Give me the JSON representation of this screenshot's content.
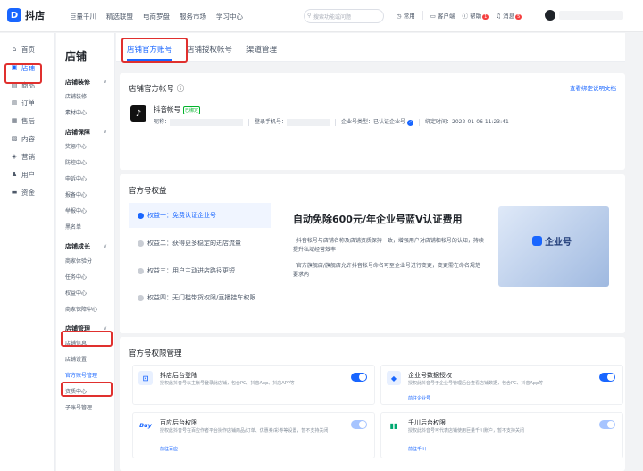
{
  "app": {
    "logo_mark": "D",
    "name": "抖店"
  },
  "topnav": [
    "巨量千川",
    "精选联盟",
    "电商罗盘",
    "服务市场",
    "学习中心"
  ],
  "search": {
    "placeholder": "搜索功能或问题"
  },
  "tools": {
    "common": "常用",
    "service": "客户端",
    "help": "帮助",
    "help_badge": "1",
    "msg": "消息",
    "msg_badge": "5"
  },
  "sidebar": [
    {
      "icon": "home-icon",
      "glyph": "⌂",
      "label": "首页"
    },
    {
      "icon": "store-icon",
      "glyph": "▣",
      "label": "店铺",
      "active": true
    },
    {
      "icon": "product-icon",
      "glyph": "▤",
      "label": "商品"
    },
    {
      "icon": "order-icon",
      "glyph": "▥",
      "label": "订单"
    },
    {
      "icon": "aftersale-icon",
      "glyph": "▦",
      "label": "售后"
    },
    {
      "icon": "content-icon",
      "glyph": "▧",
      "label": "内容"
    },
    {
      "icon": "marketing-icon",
      "glyph": "◈",
      "label": "营销"
    },
    {
      "icon": "user-icon",
      "glyph": "♟",
      "label": "用户"
    },
    {
      "icon": "funds-icon",
      "glyph": "▬",
      "label": "资金"
    }
  ],
  "subnav": {
    "title": "店铺",
    "groups": [
      {
        "label": "店铺装修",
        "items": [
          "店铺装修",
          "素材中心"
        ]
      },
      {
        "label": "店铺保障",
        "items": [
          "奖惩中心",
          "防控中心",
          "申诉中心",
          "报备中心",
          "举报中心",
          "黑名单"
        ]
      },
      {
        "label": "店铺成长",
        "items": [
          "商家体验分",
          "任务中心",
          "权益中心",
          "商家保障中心"
        ]
      },
      {
        "label": "店铺管理",
        "items": [
          "店铺信息",
          "店铺设置",
          "官方账号管理",
          "资质中心",
          "子账号管理"
        ]
      }
    ]
  },
  "tabs": [
    {
      "label": "店铺官方账号",
      "active": true
    },
    {
      "label": "店铺授权帐号"
    },
    {
      "label": "渠道管理"
    }
  ],
  "account": {
    "title": "店铺官方帐号 ⓘ",
    "doc_link": "查看绑定说明文档",
    "name": "抖音帐号",
    "verified": "已绑定",
    "nick_label": "昵称：",
    "phone_label": "登录手机号：",
    "type": "企业号类型：已认证企业号",
    "bind_time": "绑定时间：2022-01-06 11:23:41"
  },
  "rights": {
    "title": "官方号权益",
    "items": [
      "权益一：免费认证企业号",
      "权益二：获得更多稳定的进店流量",
      "权益三：用户主动进店路径更短",
      "权益四：无门槛带货权限/直播挂车权限"
    ],
    "headline": "自动免除600元/年企业号蓝V认证费用",
    "p1": "· 抖音帐号与店铺名称及店铺资质保持一致，增强用户对店铺和帐号的认知，持续提升私域经营效率",
    "p2": "· 官方旗舰店/旗舰店允许抖音帐号命名可至企业号进行变更，变更需在命名规范要求内",
    "image_text": "企业号"
  },
  "perms": {
    "title": "官方号权限管理",
    "items": [
      {
        "icon": "douyin-backend-icon",
        "glyph": "D",
        "color": "#1966ff",
        "bg": "#e8f0ff",
        "title": "抖店后台登陆",
        "desc": "授权此抖音号以主帐号登录此店铺，包含PC、抖音App、抖店APP等",
        "link": "",
        "on": true
      },
      {
        "icon": "enterprise-data-icon",
        "glyph": "◆",
        "color": "#1966ff",
        "bg": "#e8f0ff",
        "title": "企业号数据授权",
        "desc": "授权此抖音号于企业号管理后台查看店铺数据，包含PC、抖音App等",
        "link": "前往企业号",
        "on": true
      },
      {
        "icon": "baiying-icon",
        "glyph": "Buy",
        "color": "#1966ff",
        "bg": "#eef3ff",
        "title": "百应后台权限",
        "desc": "授权此抖音号在百应作者平台操作店铺商品/订单、优惠券/彩券等设置，暂不支持关闭",
        "link": "前往百应",
        "on": false
      },
      {
        "icon": "qianchuan-icon",
        "glyph": "▮",
        "color": "#00a870",
        "bg": "#e6f7f0",
        "title": "千川后台权限",
        "desc": "授权此抖音号可代表店铺使用巨量千川账户，暂不支持关闭",
        "link": "前往千川",
        "on": false
      }
    ]
  }
}
